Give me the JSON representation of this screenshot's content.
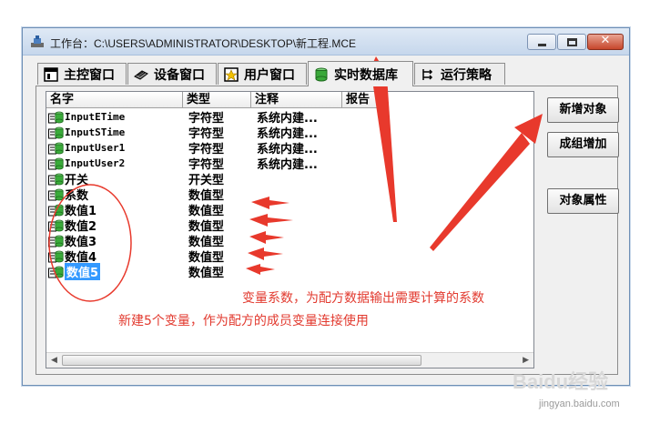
{
  "window": {
    "title": "工作台：C:\\USERS\\ADMINISTRATOR\\DESKTOP\\新工程.MCE",
    "close_glyph": "✕"
  },
  "tabs": [
    {
      "label": "主控窗口",
      "icon": "main-window-icon"
    },
    {
      "label": "设备窗口",
      "icon": "device-icon"
    },
    {
      "label": "用户窗口",
      "icon": "user-window-icon"
    },
    {
      "label": "实时数据库",
      "icon": "database-icon",
      "active": true
    },
    {
      "label": "运行策略",
      "icon": "strategy-icon"
    }
  ],
  "table": {
    "columns": [
      "名字",
      "类型",
      "注释",
      "报告"
    ],
    "rows": [
      {
        "name": "InputETime",
        "type": "字符型",
        "note": "系统内建..."
      },
      {
        "name": "InputSTime",
        "type": "字符型",
        "note": "系统内建..."
      },
      {
        "name": "InputUser1",
        "type": "字符型",
        "note": "系统内建..."
      },
      {
        "name": "InputUser2",
        "type": "字符型",
        "note": "系统内建..."
      },
      {
        "name": "开关",
        "type": "开关型",
        "note": ""
      },
      {
        "name": "系数",
        "type": "数值型",
        "note": ""
      },
      {
        "name": "数值1",
        "type": "数值型",
        "note": ""
      },
      {
        "name": "数值2",
        "type": "数值型",
        "note": ""
      },
      {
        "name": "数值3",
        "type": "数值型",
        "note": ""
      },
      {
        "name": "数值4",
        "type": "数值型",
        "note": ""
      },
      {
        "name": "数值5",
        "type": "数值型",
        "note": "",
        "selected": true
      }
    ]
  },
  "buttons": {
    "new_object": "新增对象",
    "group_add": "成组增加",
    "object_props": "对象属性"
  },
  "annotations": {
    "coefficient": "变量系数，为配方数据输出需要计算的系数",
    "new_vars": "新建5个变量，作为配方的成员变量连接使用"
  },
  "colors": {
    "annotation_red": "#e23a2f",
    "selection": "#3399ff"
  },
  "watermark": {
    "brand": "Baidu经验",
    "url": "jingyan.baidu.com"
  }
}
